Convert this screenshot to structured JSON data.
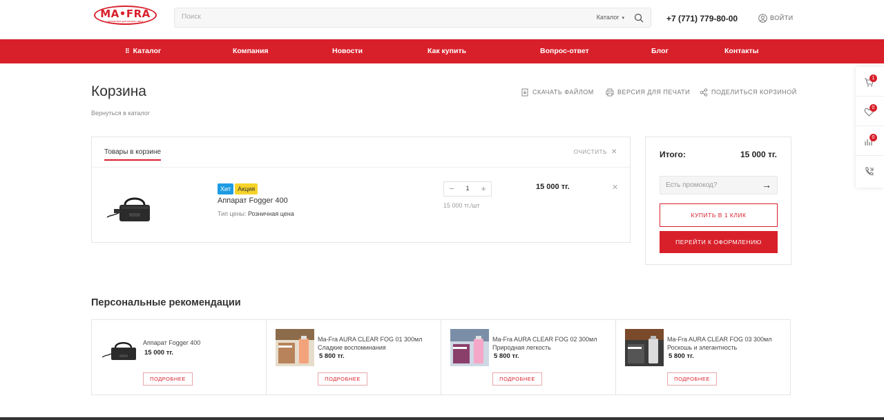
{
  "header": {
    "logo_text": "MA•FRA",
    "logo_sub": "косметика для вашего авто",
    "search_placeholder": "Поиск",
    "search_category": "Каталог",
    "phone": "+7 (771) 779-80-00",
    "login": "ВОЙТИ"
  },
  "nav": {
    "items": [
      "Каталог",
      "Компания",
      "Новости",
      "Как купить",
      "Вопрос-ответ",
      "Блог",
      "Контакты"
    ]
  },
  "page": {
    "title": "Корзина",
    "back_link": "Вернуться в каталог",
    "actions": {
      "download": "СКАЧАТЬ ФАЙЛОМ",
      "print": "ВЕРСИЯ ДЛЯ ПЕЧАТИ",
      "share": "ПОДЕЛИТЬСЯ КОРЗИНОЙ"
    }
  },
  "cart": {
    "tab_label": "Товары в корзине",
    "clear_label": "ОЧИСТИТЬ",
    "item": {
      "badge_hit": "Хит",
      "badge_sale": "Акция",
      "name": "Аппарат Fogger 400",
      "price_type_label": "Тип цены:",
      "price_type_value": "Розничная цена",
      "quantity": "1",
      "unit_price": "15 000 тг./шт",
      "total": "15 000 тг."
    }
  },
  "summary": {
    "total_label": "Итого:",
    "total_value": "15 000 тг.",
    "promo_placeholder": "Есть промокод?",
    "buy_one_click": "КУПИТЬ В 1 КЛИК",
    "checkout": "ПЕРЕЙТИ К ОФОРМЛЕНИЮ"
  },
  "sidebar": {
    "cart_count": "1",
    "favorites_count": "0",
    "compare_count": "0"
  },
  "recommendations": {
    "title": "Персональные рекомендации",
    "more_label": "ПОДРОБНЕЕ",
    "items": [
      {
        "name": "Аппарат Fogger 400",
        "price": "15 000 тг."
      },
      {
        "name": "Ma-Fra AURA CLEAR FOG 01 300мл Сладкие воспоминания",
        "price": "5 800 тг."
      },
      {
        "name": "Ma-Fra AURA CLEAR FOG 02 300мл Природная легкость",
        "price": "5 800 тг."
      },
      {
        "name": "Ma-Fra AURA CLEAR FOG 03 300мл Роскошь и элегантность",
        "price": "5 800 тг."
      }
    ]
  },
  "colors": {
    "brand_red": "#d8202b",
    "badge_blue": "#1d9be3",
    "badge_yellow": "#f6d32a"
  }
}
